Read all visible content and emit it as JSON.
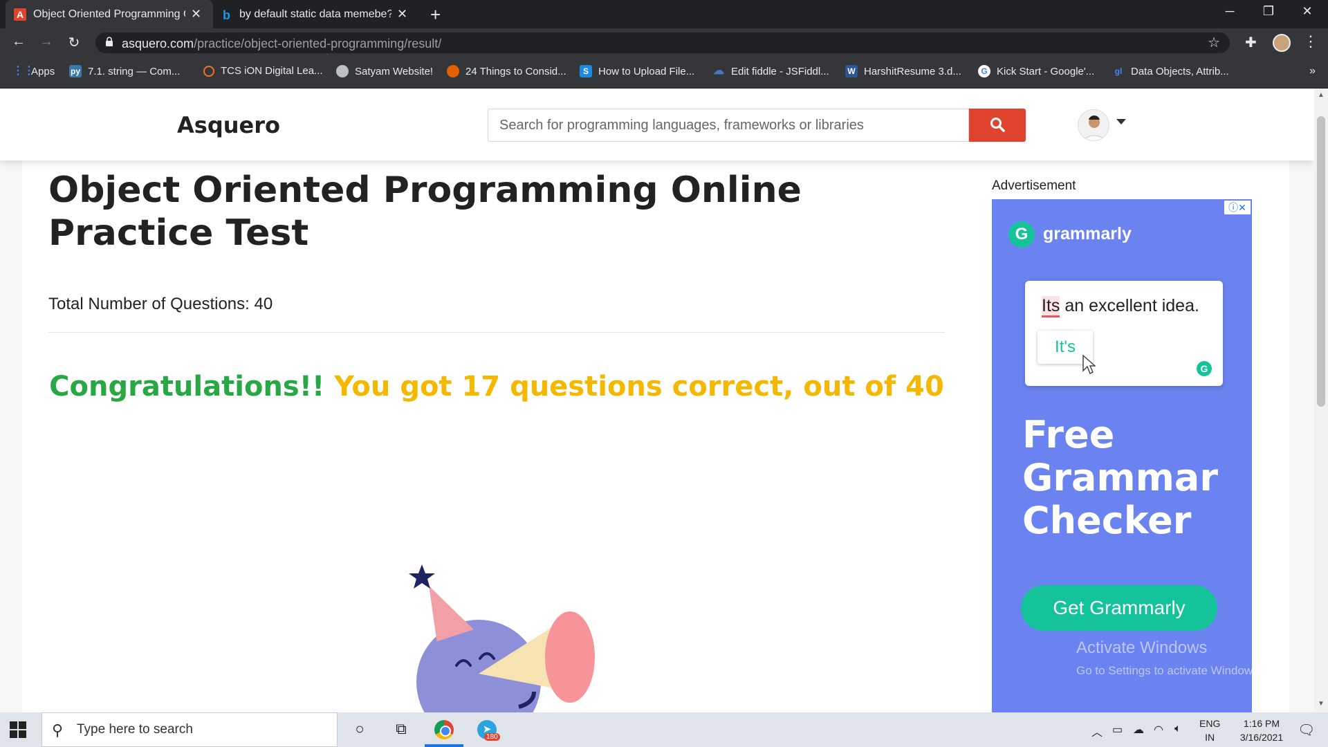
{
  "browser": {
    "tabs": [
      {
        "label": "Object Oriented Programming O",
        "active": true
      },
      {
        "label": "by default static data memebe? -",
        "active": false
      }
    ],
    "url_domain": "asquero.com",
    "url_path": "/practice/object-oriented-programming/result/",
    "bookmarks": [
      {
        "label": "Apps",
        "icon": "apps-grid-icon"
      },
      {
        "label": "7.1. string — Com...",
        "icon": "python-icon"
      },
      {
        "label": "TCS iON Digital Lea...",
        "icon": "tcs-icon"
      },
      {
        "label": "Satyam Website!",
        "icon": "globe-icon"
      },
      {
        "label": "24 Things to Consid...",
        "icon": "firefox-icon"
      },
      {
        "label": "How to Upload File...",
        "icon": "s-icon"
      },
      {
        "label": "Edit fiddle - JSFiddl...",
        "icon": "jsfiddle-icon"
      },
      {
        "label": "HarshitResume 3.d...",
        "icon": "word-icon"
      },
      {
        "label": "Kick Start - Google'...",
        "icon": "google-icon"
      },
      {
        "label": "Data Objects, Attrib...",
        "icon": "gl-icon"
      }
    ],
    "bookmarks_more": "»"
  },
  "site": {
    "logo": "Asquero",
    "search_placeholder": "Search for programming languages, frameworks or libraries"
  },
  "main": {
    "title": "Object Oriented Programming Online Practice Test",
    "total_questions_label": "Total Number of Questions: 40",
    "congrats": "Congratulations!!",
    "score_text": "You got 17 questions correct, out of 40"
  },
  "ad": {
    "label": "Advertisement",
    "close": "ⓘ✕",
    "brand": "grammarly",
    "brand_letter": "G",
    "sentence_error": "Its",
    "sentence_rest": " an excellent idea.",
    "suggestion": "It's",
    "headline": "Free Grammar Checker",
    "cta": "Get Grammarly"
  },
  "watermark": {
    "line1": "Activate Windows",
    "line2": "Go to Settings to activate Windows."
  },
  "taskbar": {
    "search_placeholder": "Type here to search",
    "telegram_badge": "180",
    "lang_line1": "ENG",
    "lang_line2": "IN",
    "time": "1:16 PM",
    "date": "3/16/2021"
  },
  "colors": {
    "congrats": "#28a745",
    "score": "#f5b800",
    "search_button": "#e0442f",
    "ad_background": "#6b83f0",
    "grammarly_green": "#15c39a"
  }
}
